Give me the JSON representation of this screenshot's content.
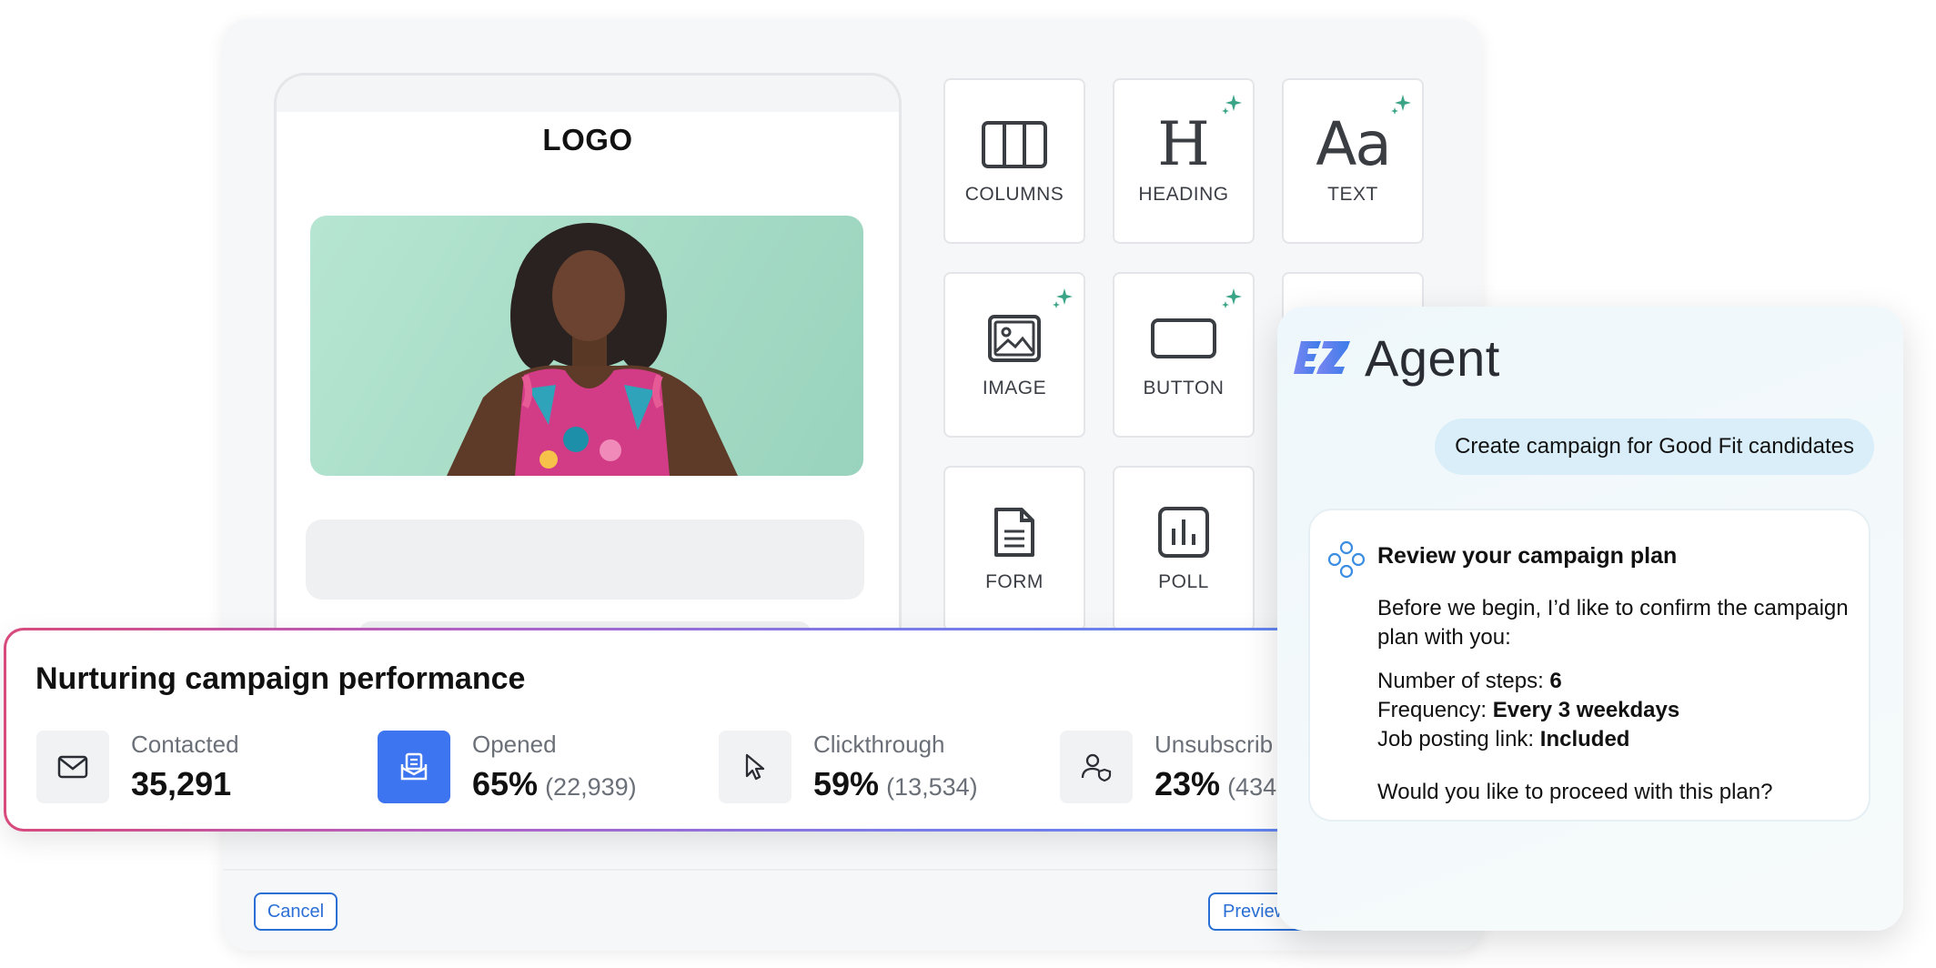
{
  "editor": {
    "logo": "LOGO",
    "blocks": [
      {
        "label": "COLUMNS",
        "icon": "columns-icon",
        "ai": false
      },
      {
        "label": "HEADING",
        "icon": "heading-icon",
        "ai": true
      },
      {
        "label": "TEXT",
        "icon": "text-icon",
        "ai": true
      },
      {
        "label": "IMAGE",
        "icon": "image-icon",
        "ai": true
      },
      {
        "label": "BUTTON",
        "icon": "button-icon",
        "ai": true
      },
      {
        "label": "FORM",
        "icon": "form-icon",
        "ai": false
      },
      {
        "label": "POLL",
        "icon": "poll-icon",
        "ai": false
      }
    ],
    "heading_glyph": "H",
    "text_glyph": "Aa",
    "cancel_label": "Cancel",
    "preview_label": "Preview",
    "accent": "#2b6fd6"
  },
  "performance": {
    "title": "Nurturing campaign performance",
    "stats": [
      {
        "label": "Contacted",
        "value": "35,291",
        "sub": "",
        "icon": "envelope-icon"
      },
      {
        "label": "Opened",
        "value": "65%",
        "sub": "(22,939)",
        "icon": "opened-mail-icon"
      },
      {
        "label": "Clickthrough",
        "value": "59%",
        "sub": "(13,534)",
        "icon": "cursor-icon"
      },
      {
        "label": "Unsubscrib",
        "value": "23%",
        "sub": "(434",
        "icon": "user-shield-icon"
      }
    ]
  },
  "agent": {
    "brand": "EZ",
    "title": "Agent",
    "user_message": "Create campaign for Good Fit candidates",
    "plan": {
      "title": "Review your campaign plan",
      "intro": "Before we begin, I’d like to confirm the campaign plan with you:",
      "items": [
        {
          "key": "Number of steps: ",
          "value": "6"
        },
        {
          "key": "Frequency: ",
          "value": "Every 3 weekdays"
        },
        {
          "key": "Job posting link: ",
          "value": "Included"
        }
      ],
      "question": "Would you like to proceed with this plan?"
    }
  }
}
